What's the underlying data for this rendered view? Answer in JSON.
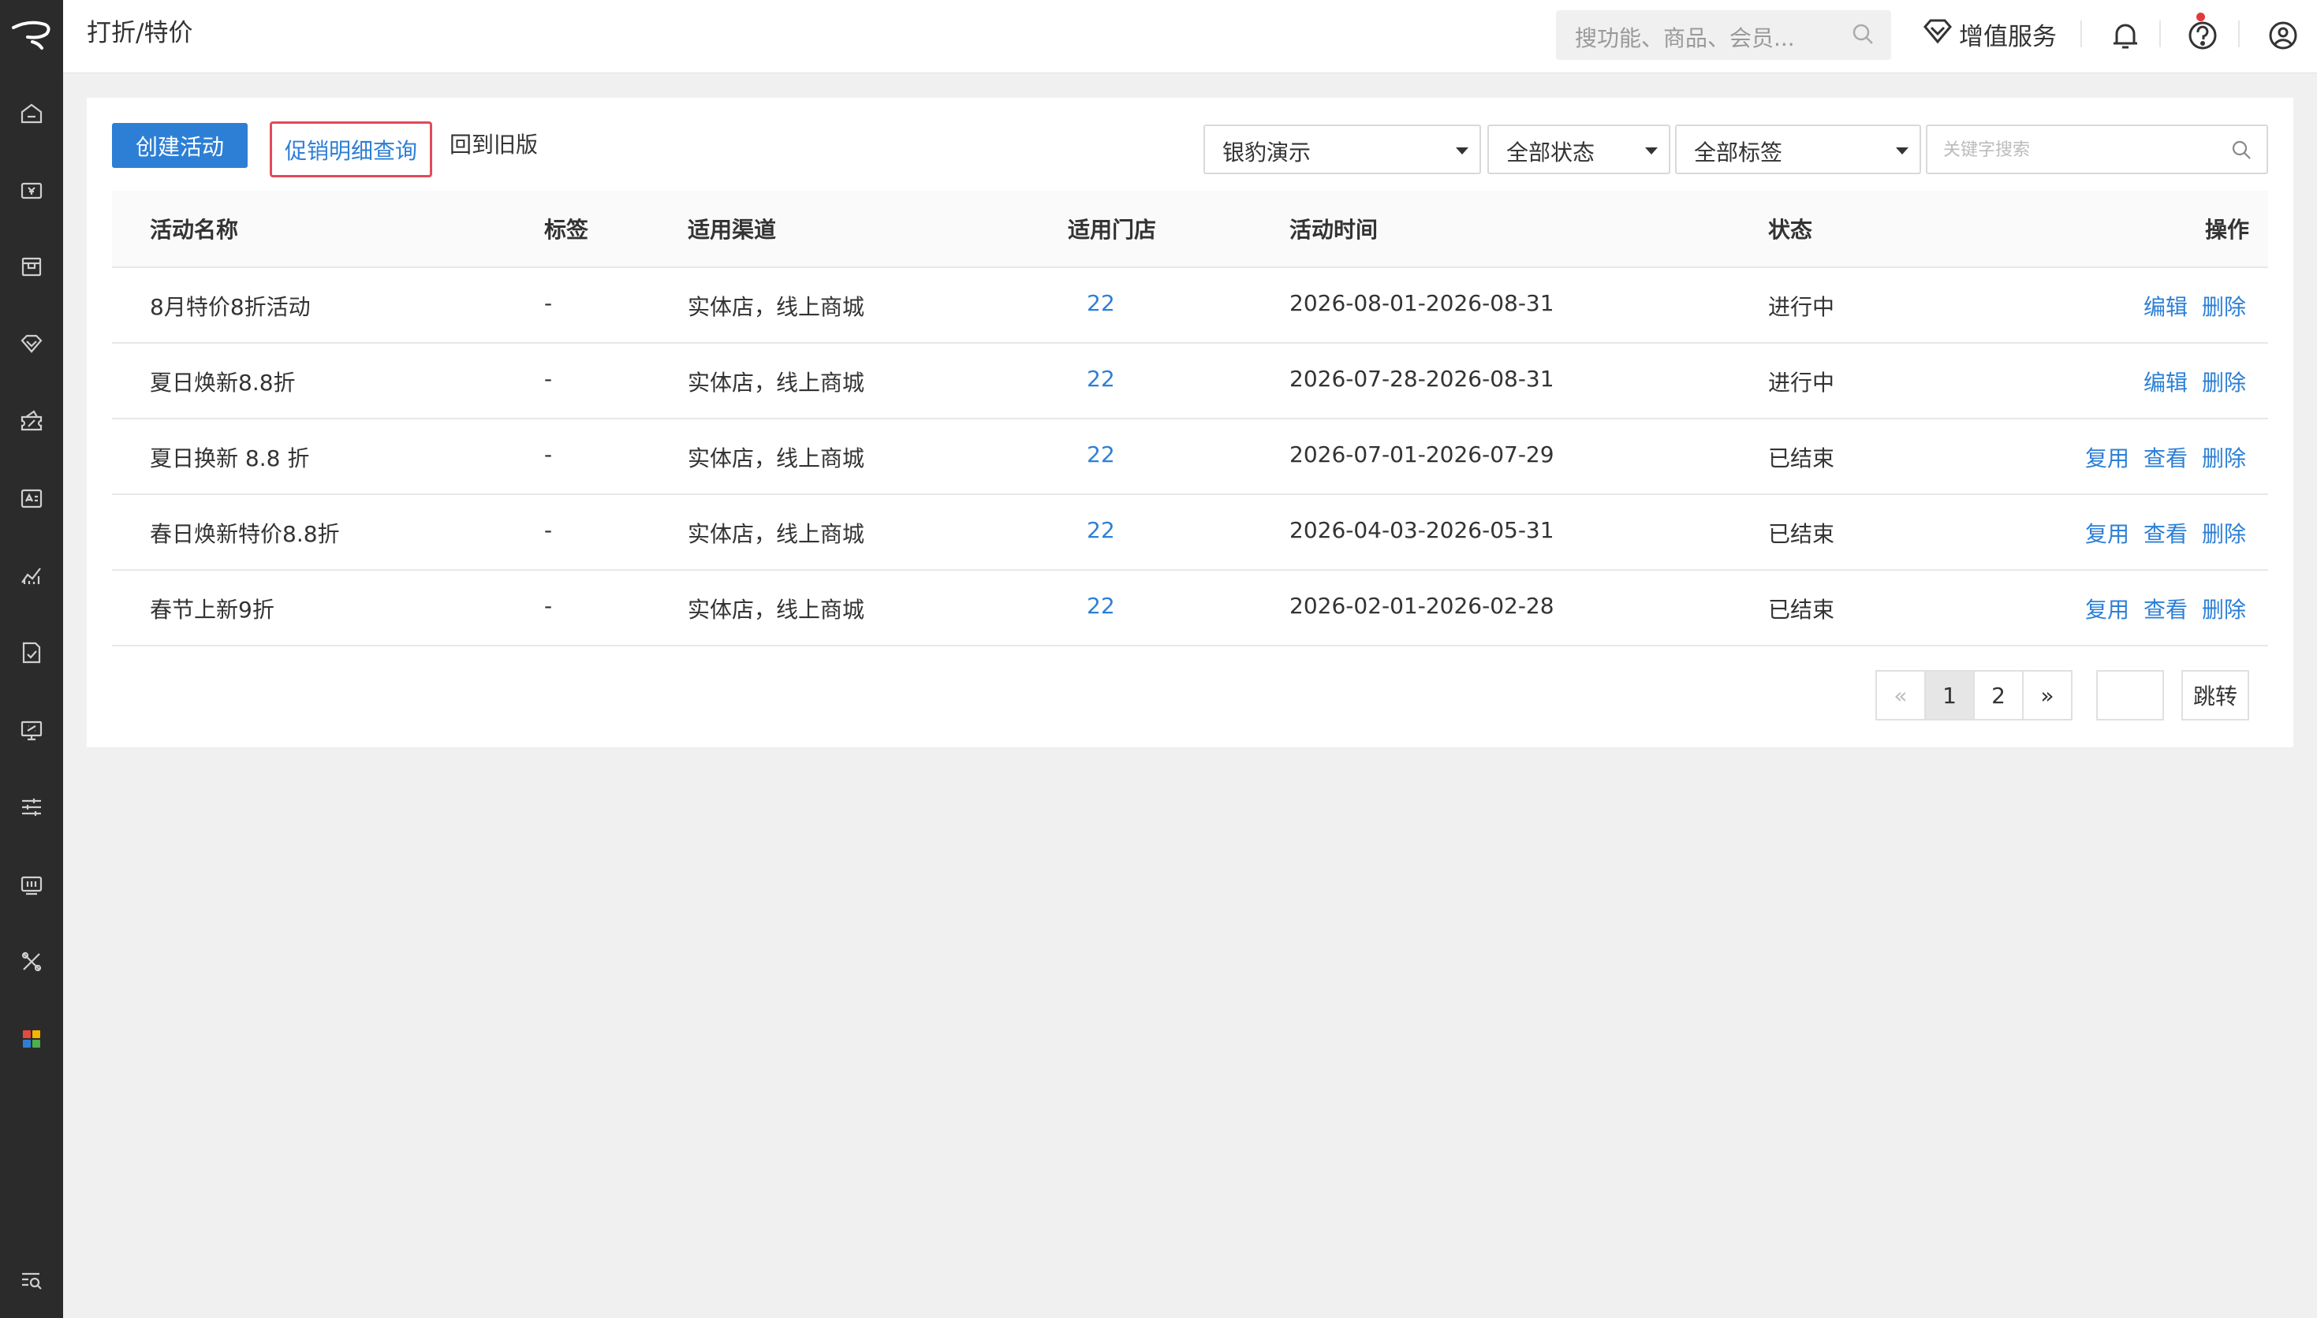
{
  "header": {
    "title": "打折/特价",
    "search_placeholder": "搜功能、商品、会员...",
    "value_added_label": "增值服务"
  },
  "sidebar": {
    "items": [
      {
        "icon": "home-icon"
      },
      {
        "icon": "cashier-icon"
      },
      {
        "icon": "goods-box-icon"
      },
      {
        "icon": "member-diamond-icon"
      },
      {
        "icon": "promotion-coupon-icon"
      },
      {
        "icon": "staff-card-icon"
      },
      {
        "icon": "report-chart-icon"
      },
      {
        "icon": "document-check-icon"
      },
      {
        "icon": "online-store-icon"
      },
      {
        "icon": "settings-sliders-icon"
      },
      {
        "icon": "device-icon"
      },
      {
        "icon": "tools-icon"
      },
      {
        "icon": "apps-grid-icon"
      },
      {
        "icon": "menu-search-icon"
      }
    ]
  },
  "toolbar": {
    "create_label": "创建活动",
    "detail_query_label": "促销明细查询",
    "old_version_label": "回到旧版",
    "store_filter": "银豹演示",
    "status_filter": "全部状态",
    "tag_filter": "全部标签",
    "keyword_placeholder": "关键字搜索"
  },
  "table": {
    "headers": {
      "name": "活动名称",
      "tag": "标签",
      "channel": "适用渠道",
      "stores": "适用门店",
      "time": "活动时间",
      "status": "状态",
      "ops": "操作"
    },
    "rows": [
      {
        "name": "8月特价8折活动",
        "tag": "-",
        "channel": "实体店，线上商城",
        "stores": "22",
        "time": "2026-08-01-2026-08-31",
        "status": "进行中",
        "op1": "编辑",
        "op2": "删除"
      },
      {
        "name": "夏日焕新8.8折",
        "tag": "-",
        "channel": "实体店，线上商城",
        "stores": "22",
        "time": "2026-07-28-2026-08-31",
        "status": "进行中",
        "op1": "编辑",
        "op2": "删除"
      },
      {
        "name": "夏日换新 8.8 折",
        "tag": "-",
        "channel": "实体店，线上商城",
        "stores": "22",
        "time": "2026-07-01-2026-07-29",
        "status": "已结束",
        "op1": "复用",
        "op2": "查看",
        "op3": "删除"
      },
      {
        "name": "春日焕新特价8.8折",
        "tag": "-",
        "channel": "实体店，线上商城",
        "stores": "22",
        "time": "2026-04-03-2026-05-31",
        "status": "已结束",
        "op1": "复用",
        "op2": "查看",
        "op3": "删除"
      },
      {
        "name": "春节上新9折",
        "tag": "-",
        "channel": "实体店，线上商城",
        "stores": "22",
        "time": "2026-02-01-2026-02-28",
        "status": "已结束",
        "op1": "复用",
        "op2": "查看",
        "op3": "删除"
      }
    ]
  },
  "pagination": {
    "prev": "«",
    "pages": [
      "1",
      "2"
    ],
    "current": "1",
    "next": "»",
    "go_label": "跳转"
  },
  "colors": {
    "accent": "#2d7fd6",
    "sidebar_bg": "#2b2b2b",
    "highlight_border": "#e24a5a",
    "notification_dot": "#e4393c"
  }
}
